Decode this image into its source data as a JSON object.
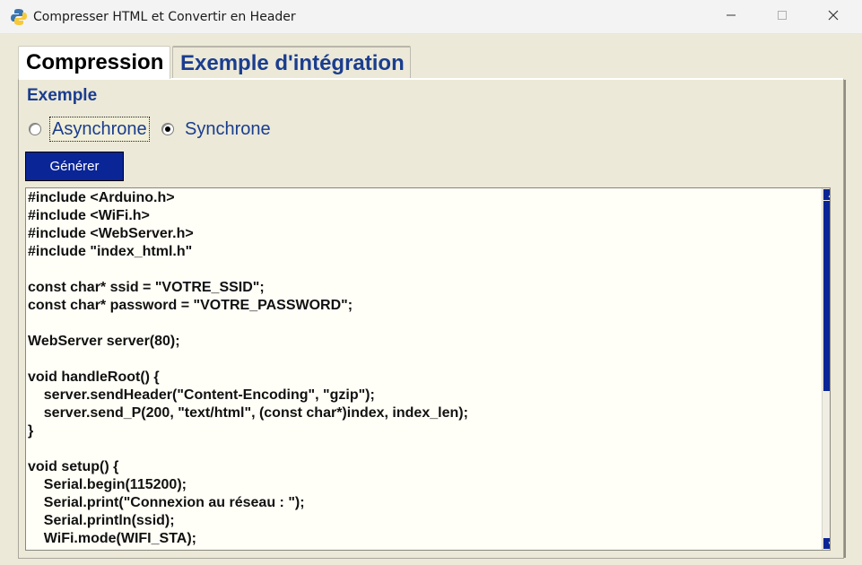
{
  "window": {
    "title": "Compresser HTML et Convertir en Header",
    "minimize_glyph": "—",
    "maximize_glyph": "☐",
    "close_glyph": "✕"
  },
  "tabs": [
    {
      "label": "Compression",
      "active": true
    },
    {
      "label": "Exemple d'intégration",
      "active": false
    }
  ],
  "section": {
    "title": "Exemple"
  },
  "mode": {
    "options": [
      {
        "label": "Asynchrone",
        "checked": false
      },
      {
        "label": "Synchrone",
        "checked": true
      }
    ]
  },
  "actions": {
    "generate_label": "Générer"
  },
  "code": {
    "lines": [
      "#include <Arduino.h>",
      "#include <WiFi.h>",
      "#include <WebServer.h>",
      "#include \"index_html.h\"",
      "",
      "const char* ssid = \"VOTRE_SSID\";",
      "const char* password = \"VOTRE_PASSWORD\";",
      "",
      "WebServer server(80);",
      "",
      "void handleRoot() {",
      "    server.sendHeader(\"Content-Encoding\", \"gzip\");",
      "    server.send_P(200, \"text/html\", (const char*)index, index_len);",
      "}",
      "",
      "void setup() {",
      "    Serial.begin(115200);",
      "    Serial.print(\"Connexion au réseau : \");",
      "    Serial.println(ssid);",
      "    WiFi.mode(WIFI_STA);"
    ]
  },
  "scroll": {
    "up_glyph": "▲",
    "down_glyph": "▼",
    "position": 0
  },
  "colors": {
    "accent": "#0a2596",
    "label_blue": "#1a3d8e",
    "window_bg": "#ece9d8"
  }
}
